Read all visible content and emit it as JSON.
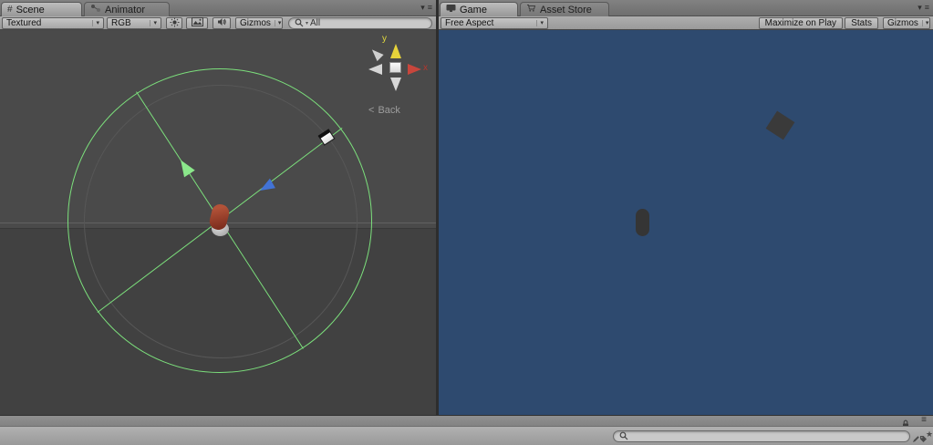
{
  "editor": {
    "left_panel": {
      "tabs": [
        {
          "label": "Scene",
          "active": true
        },
        {
          "label": "Animator",
          "active": false
        }
      ],
      "toolbar": {
        "render_mode": "Textured",
        "color_mode": "RGB",
        "gizmos": "Gizmos",
        "search_value": "All"
      },
      "scene_view": {
        "axis_y": "y",
        "axis_x": "x",
        "view_chevron": "<",
        "view_label": "Back"
      }
    },
    "right_panel": {
      "tabs": [
        {
          "label": "Game",
          "active": true
        },
        {
          "label": "Asset Store",
          "active": false
        }
      ],
      "toolbar": {
        "aspect": "Free Aspect",
        "maximize": "Maximize on Play",
        "stats": "Stats",
        "gizmos": "Gizmos"
      }
    },
    "bottom": {
      "search_value": ""
    }
  },
  "icons": {
    "scene_hash": "#",
    "dropdown_arrow": "▾",
    "panel_menu_arrow": "▾",
    "panel_menu_burger": "≡",
    "favorite_star": "★"
  },
  "colors": {
    "scene_background": "#4A4A4A",
    "game_background": "#2E4A6F",
    "rotation_circle_green": "#7CE07C",
    "axis_green": "#8BE78B",
    "axis_blue": "#4273D6",
    "axis_red": "#C8463C",
    "axis_yellow": "#E6D33A",
    "player_object_red": "#9C4630",
    "game_object_gray": "#3A3A3A"
  }
}
